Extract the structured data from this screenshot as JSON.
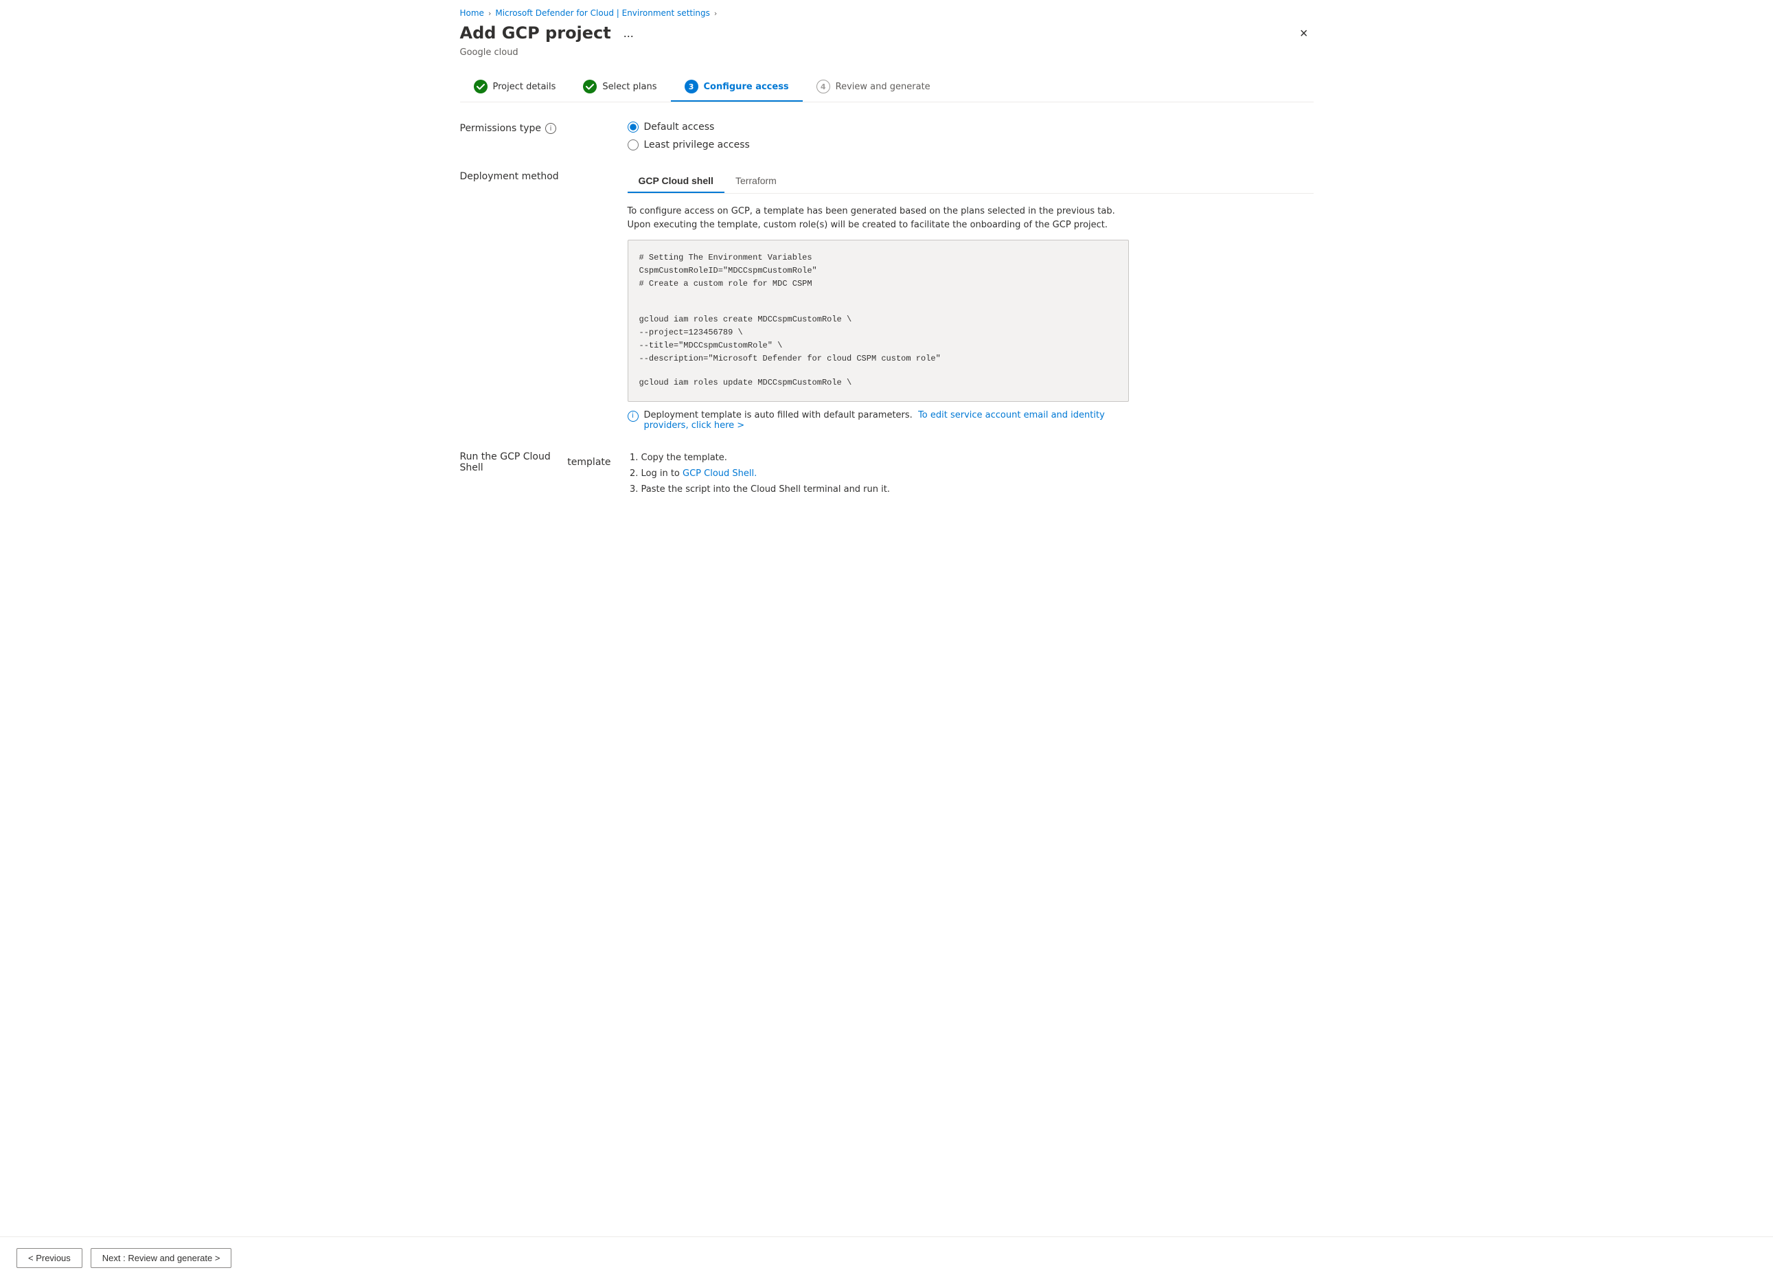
{
  "breadcrumb": {
    "items": [
      {
        "label": "Home",
        "href": "#"
      },
      {
        "label": "Microsoft Defender for Cloud | Environment settings",
        "href": "#"
      }
    ],
    "separators": [
      ">",
      ">"
    ]
  },
  "page": {
    "title": "Add GCP project",
    "subtitle": "Google cloud",
    "ellipsis_label": "...",
    "close_label": "×"
  },
  "steps": [
    {
      "id": "step1",
      "number": "✓",
      "label": "Project details",
      "state": "completed"
    },
    {
      "id": "step2",
      "number": "✓",
      "label": "Select plans",
      "state": "completed"
    },
    {
      "id": "step3",
      "number": "3",
      "label": "Configure access",
      "state": "active"
    },
    {
      "id": "step4",
      "number": "4",
      "label": "Review and generate",
      "state": "pending"
    }
  ],
  "permissions": {
    "label": "Permissions type",
    "options": [
      {
        "id": "default",
        "label": "Default access",
        "checked": true
      },
      {
        "id": "least",
        "label": "Least privilege access",
        "checked": false
      }
    ]
  },
  "deployment": {
    "label": "Deployment method",
    "tabs": [
      {
        "id": "gcp",
        "label": "GCP Cloud shell",
        "active": true
      },
      {
        "id": "terraform",
        "label": "Terraform",
        "active": false
      }
    ],
    "description": "To configure access on GCP, a template has been generated based on the plans selected in the previous tab.\nUpon executing the template, custom role(s) will be created to facilitate the onboarding of the GCP project.",
    "code_lines": [
      "# Setting The Environment Variables",
      "CspmCustomRoleID=\"MDCCspmCustomRole\"",
      "# Create a custom role for MDC CSPM",
      "",
      "",
      "gcloud iam roles create MDCCspmCustomRole \\",
      "--project=123456789 \\",
      "--title=\"MDCCspmCustomRole\" \\",
      "--description=\"Microsoft Defender for cloud CSPM custom role\"",
      "",
      "gcloud iam roles update MDCCspmCustomRole \\"
    ],
    "note_text": "Deployment template is auto filled with default parameters.",
    "note_link": "To edit service account email and identity providers, click here >"
  },
  "run_template": {
    "label_line1": "Run the GCP Cloud Shell",
    "label_line2": "template",
    "steps": [
      "Copy the template.",
      "Log in to GCP Cloud Shell.",
      "Paste the script into the Cloud Shell terminal and run it."
    ],
    "gcp_link": "GCP Cloud Shell."
  },
  "footer": {
    "prev_label": "< Previous",
    "next_label": "Next : Review and generate >"
  }
}
